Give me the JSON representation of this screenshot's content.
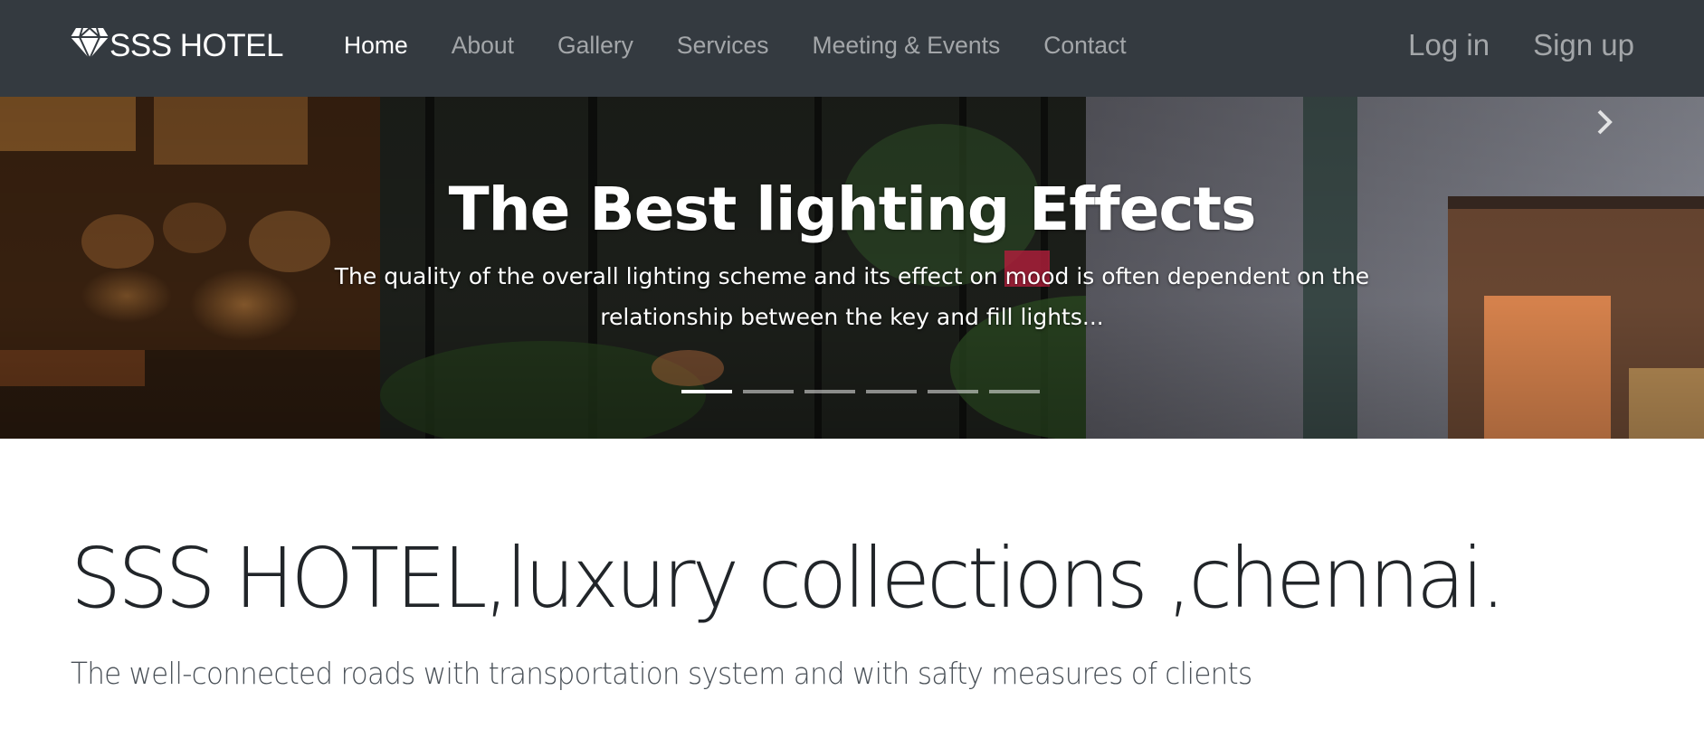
{
  "navbar": {
    "brand": "SSS HOTEL",
    "brand_icon": "diamond-icon",
    "links": [
      {
        "label": "Home",
        "active": true
      },
      {
        "label": "About"
      },
      {
        "label": "Gallery"
      },
      {
        "label": "Services"
      },
      {
        "label": "Meeting & Events"
      },
      {
        "label": "Contact"
      }
    ],
    "login_label": "Log in",
    "signup_label": "Sign up",
    "background_color": "#343a40"
  },
  "carousel": {
    "title": "The Best lighting Effects",
    "text": "The quality of the overall lighting scheme and its effect on mood is often dependent on the relationship between the key and fill lights...",
    "slide_count": 6,
    "active_slide": 1,
    "next_icon": "chevron-right-icon"
  },
  "jumbotron": {
    "title": "SSS HOTEL,luxury collections ,chennai.",
    "lead": "The well-connected roads with transportation system and with safty measures of clients"
  }
}
